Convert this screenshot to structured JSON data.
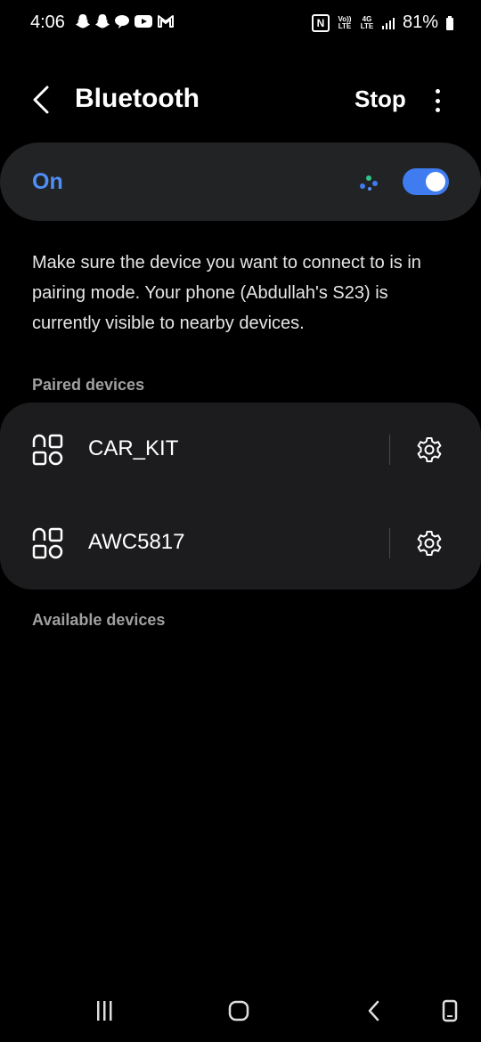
{
  "status_bar": {
    "time": "4:06",
    "left_icons": [
      "snapchat-icon",
      "snapchat-icon",
      "chat-icon",
      "youtube-icon",
      "gmail-icon"
    ],
    "nfc": "N",
    "volte": "Vo)) LTE",
    "network": "4G LTE",
    "battery_percent": "81%"
  },
  "header": {
    "title": "Bluetooth",
    "stop_label": "Stop"
  },
  "toggle": {
    "label": "On",
    "enabled": true
  },
  "description": "Make sure the device you want to connect to is in pairing mode. Your phone (Abdullah's S23) is currently visible to nearby devices.",
  "paired": {
    "header": "Paired devices",
    "devices": [
      {
        "name": "CAR_KIT"
      },
      {
        "name": "AWC5817"
      }
    ]
  },
  "available": {
    "header": "Available devices"
  },
  "colors": {
    "accent": "#4f8ef7",
    "switch_on": "#3e7cf0",
    "card_bg": "#222325",
    "list_bg": "#1c1c1e",
    "background": "#000000"
  }
}
